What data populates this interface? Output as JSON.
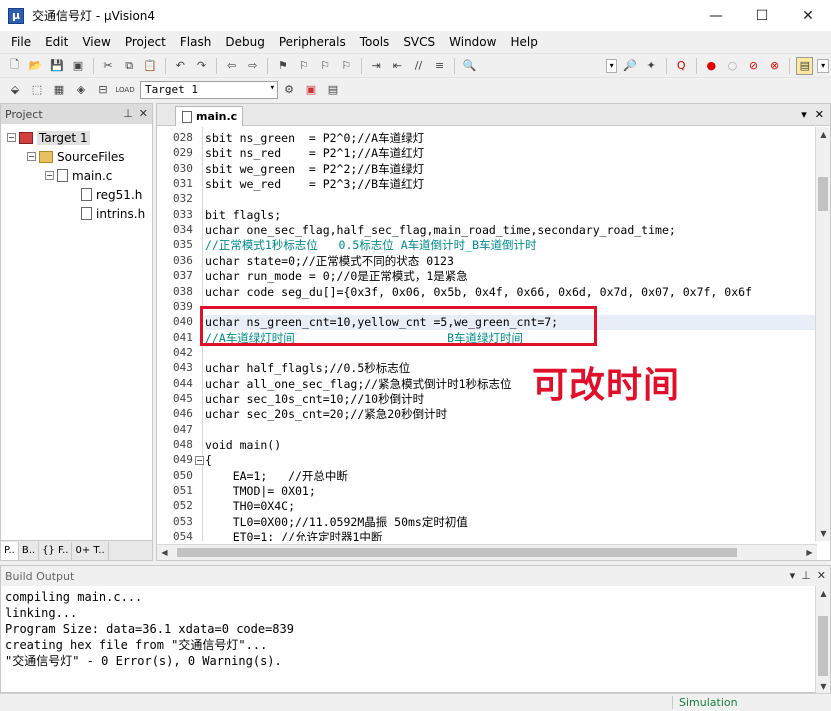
{
  "window": {
    "icon": "µ",
    "title": "交通信号灯 - µVision4",
    "controls": {
      "minimize": "—",
      "maximize": "☐",
      "close": "✕"
    }
  },
  "menu": [
    "File",
    "Edit",
    "View",
    "Project",
    "Flash",
    "Debug",
    "Peripherals",
    "Tools",
    "SVCS",
    "Window",
    "Help"
  ],
  "toolbar2": {
    "target": "Target 1"
  },
  "project_panel": {
    "title": "Project",
    "tree": {
      "target": "Target 1",
      "group": "SourceFiles",
      "file": "main.c",
      "includes": [
        "reg51.h",
        "intrins.h"
      ]
    },
    "tabs": [
      "P..",
      "B..",
      "{} F..",
      "0+ T.."
    ]
  },
  "editor": {
    "tab": "main.c",
    "lines": [
      {
        "n": "028",
        "t": "sbit ns_green  = P2^0;//A车道绿灯",
        "hl": false
      },
      {
        "n": "029",
        "t": "sbit ns_red    = P2^1;//A车道红灯",
        "hl": false
      },
      {
        "n": "030",
        "t": "sbit we_green  = P2^2;//B车道绿灯",
        "hl": false
      },
      {
        "n": "031",
        "t": "sbit we_red    = P2^3;//B车道红灯",
        "hl": false
      },
      {
        "n": "032",
        "t": "",
        "hl": false
      },
      {
        "n": "033",
        "t": "bit flagls;",
        "hl": false
      },
      {
        "n": "034",
        "t": "uchar one_sec_flag,half_sec_flag,main_road_time,secondary_road_time;",
        "hl": false
      },
      {
        "n": "035",
        "t": "//正常模式1秒标志位   0.5标志位 A车道倒计时_B车道倒计时",
        "hl": false
      },
      {
        "n": "036",
        "t": "uchar state=0;//正常模式不同的状态 0123",
        "hl": false
      },
      {
        "n": "037",
        "t": "uchar run_mode = 0;//0是正常模式，1是紧急",
        "hl": false
      },
      {
        "n": "038",
        "t": "uchar code seg_du[]={0x3f, 0x06, 0x5b, 0x4f, 0x66, 0x6d, 0x7d, 0x07, 0x7f, 0x6f",
        "hl": false
      },
      {
        "n": "039",
        "t": "",
        "hl": false
      },
      {
        "n": "040",
        "t": "uchar ns_green_cnt=10,yellow_cnt =5,we_green_cnt=7;",
        "hl": true
      },
      {
        "n": "041",
        "t": "//A车道绿灯时间                     _B车道绿灯时间",
        "hl": false
      },
      {
        "n": "042",
        "t": "",
        "hl": false
      },
      {
        "n": "043",
        "t": "uchar half_flagls;//0.5秒标志位",
        "hl": false
      },
      {
        "n": "044",
        "t": "uchar all_one_sec_flag;//紧急模式倒计时1秒标志位",
        "hl": false
      },
      {
        "n": "045",
        "t": "uchar sec_10s_cnt=10;//10秒倒计时",
        "hl": false
      },
      {
        "n": "046",
        "t": "uchar sec_20s_cnt=20;//紧急20秒倒计时",
        "hl": false
      },
      {
        "n": "047",
        "t": "",
        "hl": false
      },
      {
        "n": "048",
        "t": "void main()",
        "hl": false
      },
      {
        "n": "049",
        "t": "{",
        "hl": false
      },
      {
        "n": "050",
        "t": "    EA=1;   //开总中断",
        "hl": false
      },
      {
        "n": "051",
        "t": "    TMOD|= 0X01;",
        "hl": false
      },
      {
        "n": "052",
        "t": "    TH0=0X4C;",
        "hl": false
      },
      {
        "n": "053",
        "t": "    TL0=0X00;//11.0592M晶振 50ms定时初值",
        "hl": false
      },
      {
        "n": "054",
        "t": "    ET0=1; //允许定时器1中断",
        "hl": false
      }
    ],
    "annotation": "可改时间"
  },
  "build_output": {
    "title": "Build Output",
    "lines": [
      "compiling main.c...",
      "linking...",
      "Program Size: data=36.1 xdata=0 code=839",
      "creating hex file from \"交通信号灯\"...",
      "\"交通信号灯\" - 0 Error(s), 0 Warning(s)."
    ]
  },
  "status": {
    "mode": "Simulation"
  }
}
